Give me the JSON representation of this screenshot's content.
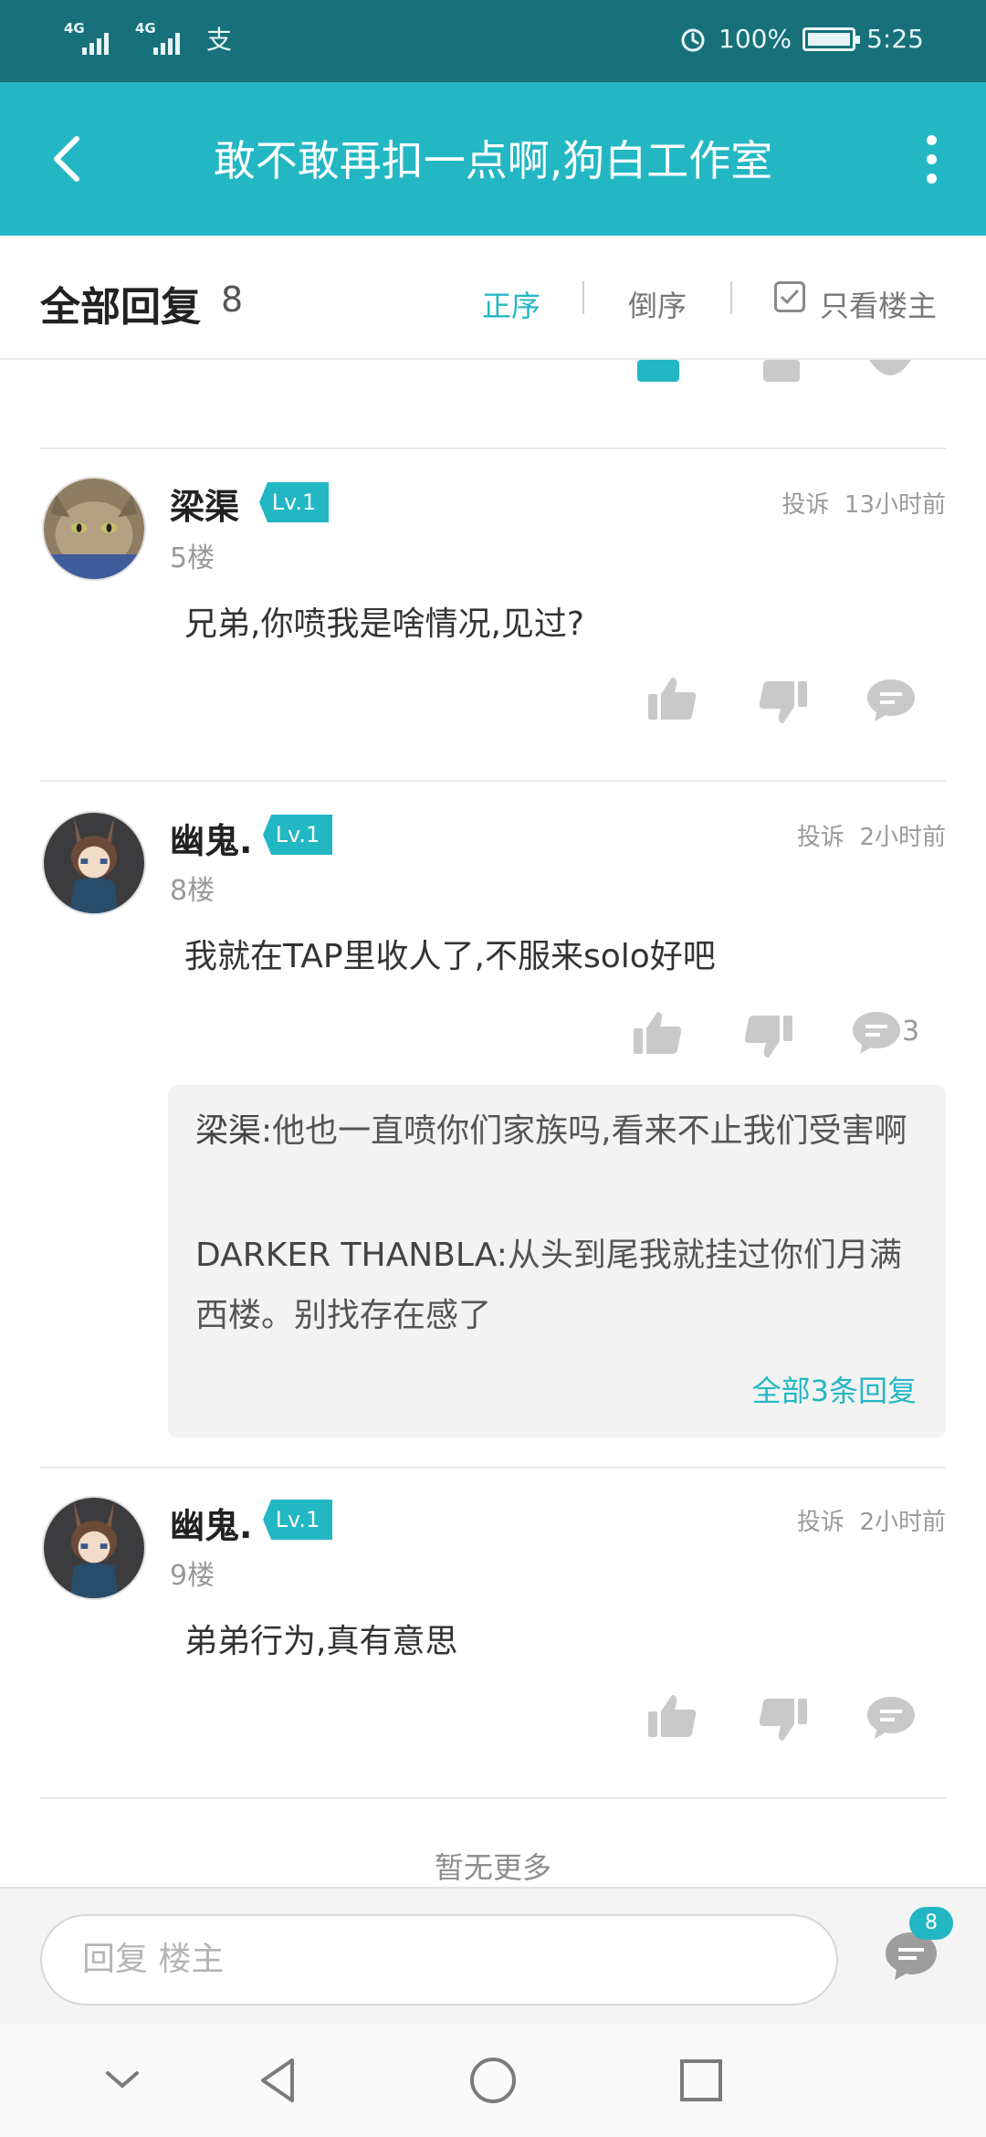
{
  "status_bar": {
    "sim1": "4G",
    "sim2": "4G",
    "app_glyph": "支",
    "battery": "100%",
    "time": "5:25",
    "icons": [
      "signal-icon",
      "alarm-icon",
      "battery-icon"
    ]
  },
  "header": {
    "title": "敢不敢再扣一点啊,狗白工作室",
    "back_icon": "back-arrow-icon",
    "more_icon": "more-vertical-icon"
  },
  "sort_bar": {
    "label": "全部回复",
    "count": "8",
    "asc": "正序",
    "desc": "倒序",
    "only_op": "只看楼主",
    "active": "正序",
    "only_op_checked": false
  },
  "comments": [
    {
      "name": "梁渠",
      "level": "Lv.1",
      "report": "投诉",
      "time": "13小时前",
      "floor": "5楼",
      "content": "兄弟,你喷我是啥情况,见过?",
      "avatar": "cat-avatar"
    },
    {
      "name": "幽鬼.",
      "level": "Lv.1",
      "report": "投诉",
      "time": "2小时前",
      "floor": "8楼",
      "content": "我就在TAP里收人了,不服来solo好吧",
      "reply_count": "3",
      "avatar": "anime-avatar",
      "sub_replies": [
        {
          "author": "梁渠:",
          "text": "他也一直喷你们家族吗,看来不止我们受害啊"
        },
        {
          "author": "DARKER THANBLA:",
          "text": "从头到尾我就挂过你们月满西楼。别找存在感了"
        }
      ],
      "all_replies": "全部3条回复"
    },
    {
      "name": "幽鬼.",
      "level": "Lv.1",
      "report": "投诉",
      "time": "2小时前",
      "floor": "9楼",
      "content": "弟弟行为,真有意思",
      "avatar": "anime-avatar"
    }
  ],
  "footer": {
    "no_more": "暂无更多",
    "reply_placeholder": "回复 楼主",
    "reply_badge": "8"
  },
  "colors": {
    "accent": "#23b7c4",
    "status_bar": "#17707a",
    "text": "#333333",
    "muted": "#9a9a9a"
  }
}
